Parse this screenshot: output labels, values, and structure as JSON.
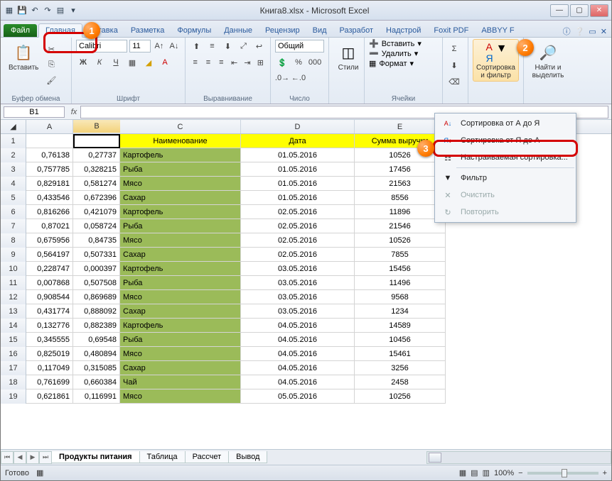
{
  "title": "Книга8.xlsx - Microsoft Excel",
  "tabs": {
    "file": "Файл",
    "home": "Главная",
    "insert": "Вставка",
    "layout": "Разметка",
    "formulas": "Формулы",
    "data": "Данные",
    "review": "Рецензир",
    "view": "Вид",
    "dev": "Разработ",
    "addins": "Надстрой",
    "foxit": "Foxit PDF",
    "abbyy": "ABBYY F"
  },
  "ribbon": {
    "paste": "Вставить",
    "clipboard": "Буфер обмена",
    "font": "Calibri",
    "size": "11",
    "fontgrp": "Шрифт",
    "align": "Выравнивание",
    "format": "Общий",
    "numgrp": "Число",
    "styles": "Стили",
    "insertc": "Вставить",
    "deletec": "Удалить",
    "formatc": "Формат",
    "cellsgrp": "Ячейки",
    "sumfn": "Σ",
    "sortbtn": "Сортировка и фильтр",
    "findbtn": "Найти и выделить"
  },
  "namebox": "B1",
  "headers": {
    "C": "Наименование",
    "D": "Дата",
    "E": "Сумма выручки"
  },
  "data_rows": [
    {
      "a": "0,76138",
      "b": "0,27737",
      "c": "Картофель",
      "d": "01.05.2016",
      "e": "10526"
    },
    {
      "a": "0,757785",
      "b": "0,328215",
      "c": "Рыба",
      "d": "01.05.2016",
      "e": "17456"
    },
    {
      "a": "0,829181",
      "b": "0,581274",
      "c": "Мясо",
      "d": "01.05.2016",
      "e": "21563"
    },
    {
      "a": "0,433546",
      "b": "0,672396",
      "c": "Сахар",
      "d": "01.05.2016",
      "e": "8556"
    },
    {
      "a": "0,816266",
      "b": "0,421079",
      "c": "Картофель",
      "d": "02.05.2016",
      "e": "11896"
    },
    {
      "a": "0,87021",
      "b": "0,058724",
      "c": "Рыба",
      "d": "02.05.2016",
      "e": "21546"
    },
    {
      "a": "0,675956",
      "b": "0,84735",
      "c": "Мясо",
      "d": "02.05.2016",
      "e": "10526"
    },
    {
      "a": "0,564197",
      "b": "0,507331",
      "c": "Сахар",
      "d": "02.05.2016",
      "e": "7855"
    },
    {
      "a": "0,228747",
      "b": "0,000397",
      "c": "Картофель",
      "d": "03.05.2016",
      "e": "15456"
    },
    {
      "a": "0,007868",
      "b": "0,507508",
      "c": "Рыба",
      "d": "03.05.2016",
      "e": "11496"
    },
    {
      "a": "0,908544",
      "b": "0,869689",
      "c": "Мясо",
      "d": "03.05.2016",
      "e": "9568"
    },
    {
      "a": "0,431774",
      "b": "0,888092",
      "c": "Сахар",
      "d": "03.05.2016",
      "e": "1234"
    },
    {
      "a": "0,132776",
      "b": "0,882389",
      "c": "Картофель",
      "d": "04.05.2016",
      "e": "14589"
    },
    {
      "a": "0,345555",
      "b": "0,69548",
      "c": "Рыба",
      "d": "04.05.2016",
      "e": "10456"
    },
    {
      "a": "0,825019",
      "b": "0,480894",
      "c": "Мясо",
      "d": "04.05.2016",
      "e": "15461"
    },
    {
      "a": "0,117049",
      "b": "0,315085",
      "c": "Сахар",
      "d": "04.05.2016",
      "e": "3256"
    },
    {
      "a": "0,761699",
      "b": "0,660384",
      "c": "Чай",
      "d": "04.05.2016",
      "e": "2458"
    },
    {
      "a": "0,621861",
      "b": "0,116991",
      "c": "Мясо",
      "d": "05.05.2016",
      "e": "10256"
    }
  ],
  "sheets": {
    "s1": "Продукты питания",
    "s2": "Таблица",
    "s3": "Рассчет",
    "s4": "Вывод"
  },
  "status": {
    "ready": "Готово",
    "zoom": "100%"
  },
  "menu": {
    "az": "Сортировка от А до Я",
    "za": "Сортировка от Я до А",
    "custom": "Настраиваемая сортировка...",
    "filter": "Фильтр",
    "clear": "Очистить",
    "reapply": "Повторить"
  },
  "markers": {
    "m1": "1",
    "m2": "2",
    "m3": "3"
  }
}
